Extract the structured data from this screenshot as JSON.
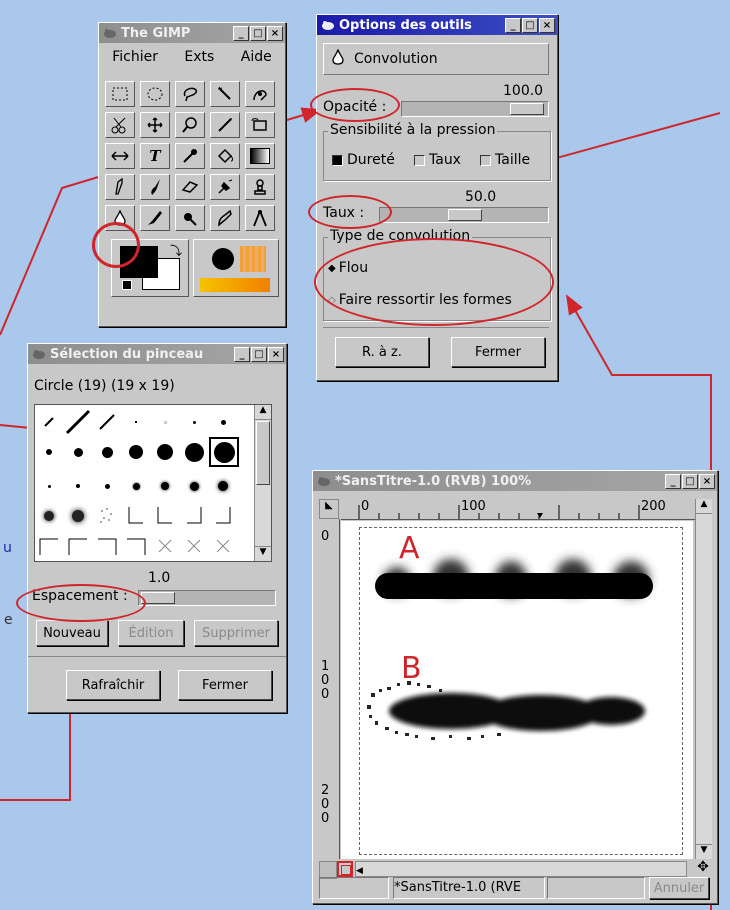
{
  "gimp": {
    "title": "The GIMP",
    "menu": [
      "Fichier",
      "Exts",
      "Aide"
    ]
  },
  "options": {
    "title": "Options des outils",
    "tool_name": "Convolution",
    "opacity_label": "Opacité :",
    "opacity_value": "100.0",
    "opacity_fraction": 1.0,
    "pressure_title": "Sensibilité à la pression",
    "pressure_checks": [
      "Dureté",
      "Taux",
      "Taille"
    ],
    "rate_label": "Taux :",
    "rate_value": "50.0",
    "rate_fraction": 0.5,
    "conv_title": "Type de convolution",
    "radio_blur": "Flou",
    "radio_sharpen": "Faire ressortir les formes",
    "reset_button": "R. à z.",
    "close_button": "Fermer"
  },
  "brushes": {
    "title": "Sélection du pinceau",
    "info": "Circle (19)  (19 x 19)",
    "spacing_value": "1.0",
    "spacing_label": "Espacement :",
    "new_button": "Nouveau",
    "edit_button": "Édition",
    "delete_button": "Supprimer",
    "refresh_button": "Rafraîchir",
    "close_button": "Fermer"
  },
  "canvas": {
    "title": "*SansTitre-1.0 (RVB) 100%",
    "ruler_marks": [
      "0",
      "100",
      "200"
    ],
    "vruler_marks": [
      "0",
      "1",
      "0",
      "0",
      "2",
      "0",
      "0"
    ],
    "label_a": "A",
    "label_b": "B",
    "status_name": "*SansTitre-1.0 (RVE",
    "cancel_button": "Annuler"
  },
  "bg_fragments": {
    "u": "u",
    "e": "e"
  },
  "colors": {
    "annotation": "#d0252b",
    "title_active": "#1a1aa8",
    "background": "#a9c8ec"
  }
}
